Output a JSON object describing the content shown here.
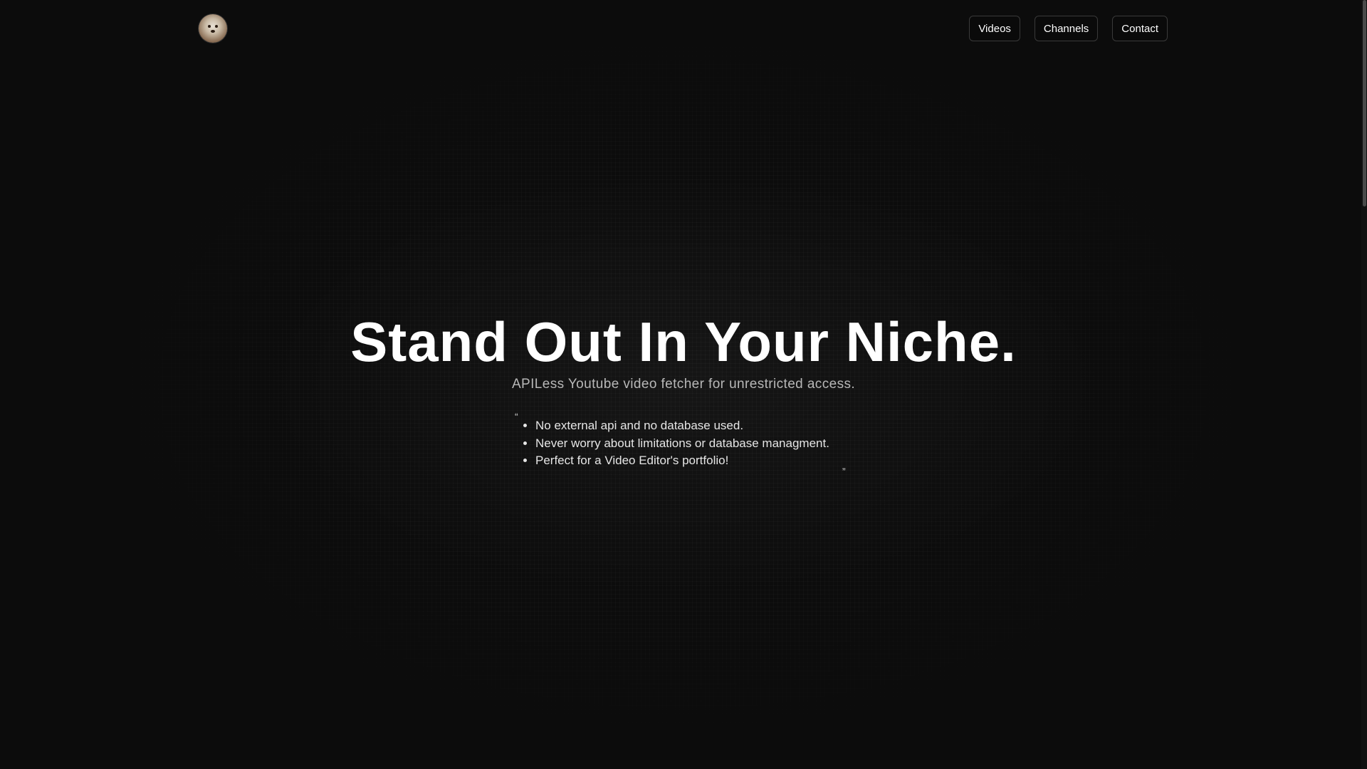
{
  "header": {
    "logo_alt": "avatar",
    "nav": [
      {
        "label": "Videos"
      },
      {
        "label": "Channels"
      },
      {
        "label": "Contact"
      }
    ]
  },
  "hero": {
    "title": "Stand Out In Your Niche.",
    "subtitle": "APILess Youtube video fetcher for unrestricted access.",
    "quote_open": "“",
    "quote_close": "”",
    "features": [
      "No external api and no database used.",
      "Never worry about limitations or database managment.",
      "Perfect for a Video Editor's portfolio!"
    ]
  },
  "theme": {
    "background": "#0c0c0c",
    "text": "#ffffff",
    "muted_text": "#b8b8b8",
    "button_border": "#3a3a3a"
  }
}
